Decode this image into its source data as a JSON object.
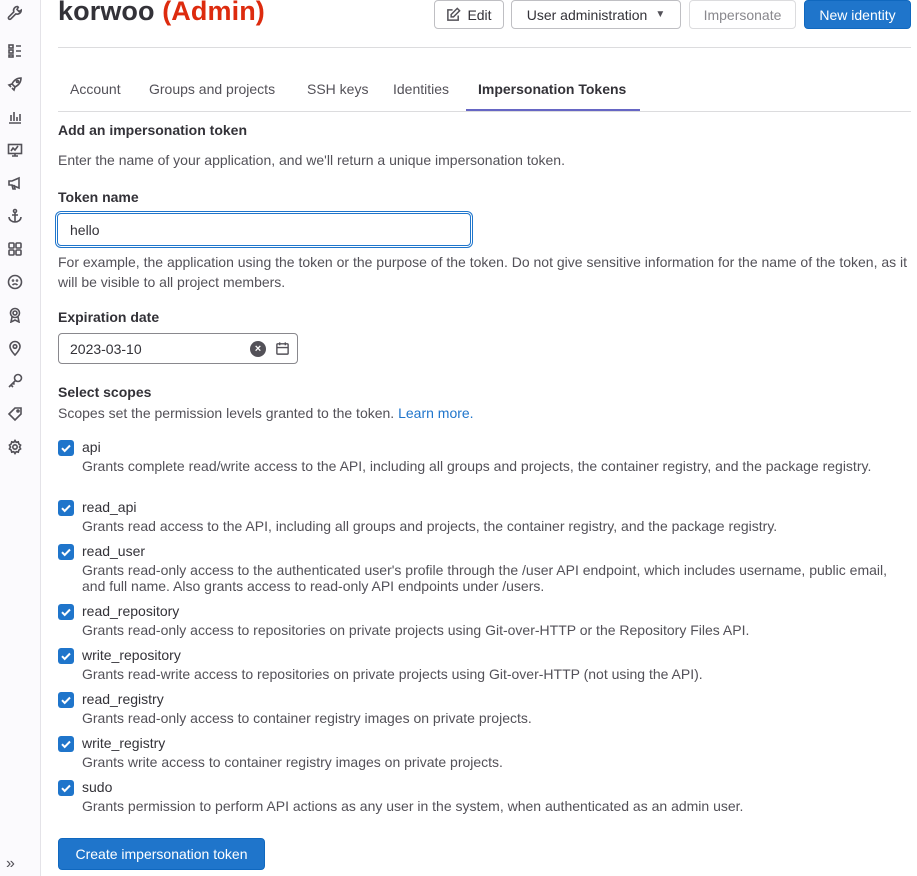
{
  "header": {
    "title_user": "korwoo",
    "title_badge": "(Admin)",
    "edit_label": "Edit",
    "user_admin_label": "User administration",
    "impersonate_label": "Impersonate",
    "new_identity_label": "New identity"
  },
  "tabs": [
    {
      "label": "Account"
    },
    {
      "label": "Groups and projects"
    },
    {
      "label": "SSH keys"
    },
    {
      "label": "Identities"
    },
    {
      "label": "Impersonation Tokens",
      "active": true
    }
  ],
  "form": {
    "section_title": "Add an impersonation token",
    "section_desc": "Enter the name of your application, and we'll return a unique impersonation token.",
    "token_name_label": "Token name",
    "token_name_value": "hello",
    "token_name_help": "For example, the application using the token or the purpose of the token. Do not give sensitive information for the name of the token, as it will be visible to all project members.",
    "expiration_label": "Expiration date",
    "expiration_value": "2023-03-10",
    "scopes_label": "Select scopes",
    "scopes_desc": "Scopes set the permission levels granted to the token.",
    "learn_more": "Learn more.",
    "submit_label": "Create impersonation token"
  },
  "scopes": [
    {
      "name": "api",
      "checked": true,
      "desc": "Grants complete read/write access to the API, including all groups and projects, the container registry, and the package registry."
    },
    {
      "name": "read_api",
      "checked": true,
      "desc": "Grants read access to the API, including all groups and projects, the container registry, and the package registry."
    },
    {
      "name": "read_user",
      "checked": true,
      "desc": "Grants read-only access to the authenticated user's profile through the /user API endpoint, which includes username, public email, and full name. Also grants access to read-only API endpoints under /users."
    },
    {
      "name": "read_repository",
      "checked": true,
      "desc": "Grants read-only access to repositories on private projects using Git-over-HTTP or the Repository Files API."
    },
    {
      "name": "write_repository",
      "checked": true,
      "desc": "Grants read-write access to repositories on private projects using Git-over-HTTP (not using the API)."
    },
    {
      "name": "read_registry",
      "checked": true,
      "desc": "Grants read-only access to container registry images on private projects."
    },
    {
      "name": "write_registry",
      "checked": true,
      "desc": "Grants write access to container registry images on private projects."
    },
    {
      "name": "sudo",
      "checked": true,
      "desc": "Grants permission to perform API actions as any user in the system, when authenticated as an admin user."
    }
  ],
  "sidebar": {
    "icons": [
      "wrench-icon",
      "overview-icon",
      "rocket-icon",
      "analytics-icon",
      "monitor-icon",
      "messages-icon",
      "anchor-icon",
      "applications-icon",
      "abuse-icon",
      "deploy-keys-icon",
      "labels-icon",
      "key-icon",
      "tag-icon",
      "settings-icon"
    ],
    "collapse": "»"
  },
  "colors": {
    "primary": "#1f75cb",
    "admin_red": "#dd2b0e",
    "tab_active": "#6666c4"
  }
}
